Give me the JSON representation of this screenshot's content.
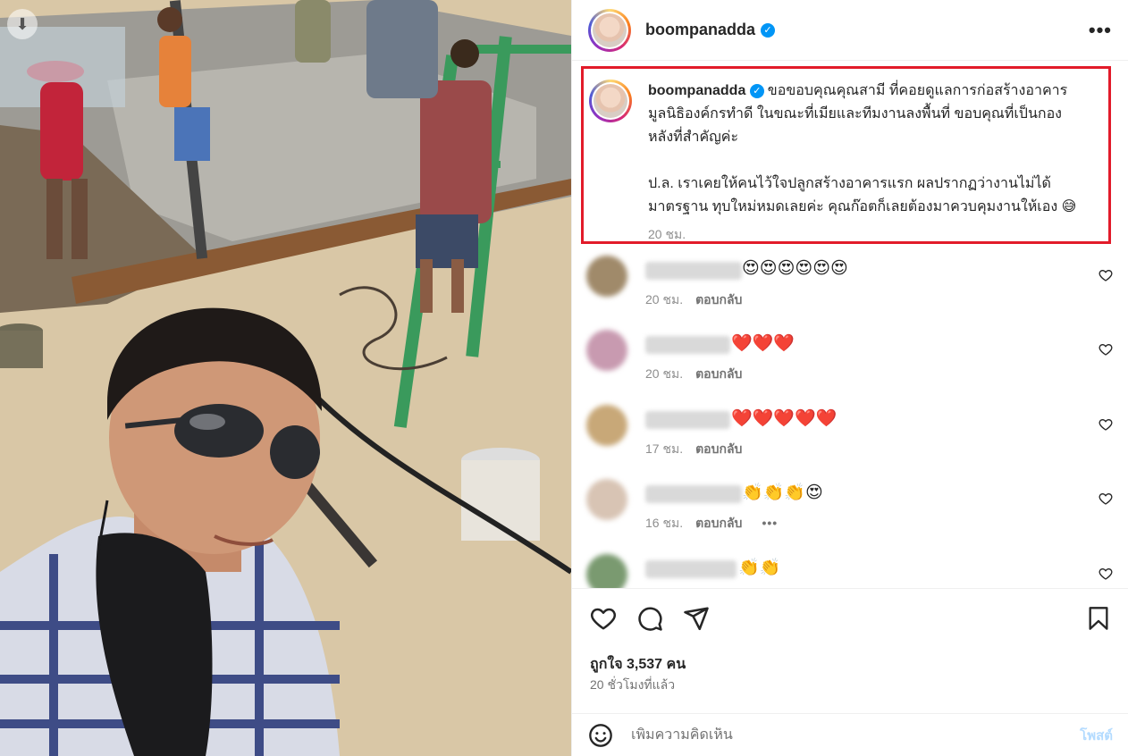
{
  "post": {
    "username": "boompanadda",
    "caption_username": "boompanadda",
    "caption": "ขอขอบคุณคุณสามี ที่คอยดูแลการก่อสร้างอาคาร\nมูลนิธิองค์กรทำดี ในขณะที่เมียและทีมงานลงพื้นที่ ขอบคุณที่เป็นกอง\nหลังที่สำคัญค่ะ\n\nป.ล. เราเคยให้คนไว้ใจปลูกสร้างอาคารแรก ผลปรากฏว่างานไม่ได้\nมาตรฐาน ทุบใหม่หมดเลยค่ะ คุณก๊อตก็เลยต้องมาควบคุมงานให้เอง 😅",
    "caption_time": "20 ชม."
  },
  "comments": [
    {
      "text": "😍😍😍😍😍😍",
      "time": "20 ชม.",
      "reply": "ตอบกลับ",
      "avatar_color": "#a08a6a"
    },
    {
      "text": "❤️❤️❤️",
      "time": "20 ชม.",
      "reply": "ตอบกลับ",
      "avatar_color": "#c89ab0"
    },
    {
      "text": "❤️❤️❤️❤️❤️",
      "time": "17 ชม.",
      "reply": "ตอบกลับ",
      "avatar_color": "#c8a878"
    },
    {
      "text": "👏👏👏😍",
      "time": "16 ชม.",
      "reply": "ตอบกลับ",
      "more": "•••",
      "avatar_color": "#d8c4b4"
    },
    {
      "text": "👏👏",
      "time": "",
      "reply": "",
      "avatar_color": "#7a9a70"
    }
  ],
  "likes": "ถูกใจ 3,537 คน",
  "posted_ago": "20 ชั่วโมงที่แล้ว",
  "add_comment": {
    "placeholder": "เพิ่มความคิดเห็น",
    "post_label": "โพสต์"
  },
  "icons": {
    "more": "more-options-icon",
    "verified": "verified-badge-icon",
    "download": "download-icon",
    "like": "heart-icon",
    "comment": "comment-icon",
    "share": "share-icon",
    "save": "bookmark-icon",
    "emoji": "emoji-icon"
  },
  "colors": {
    "verified": "#0095f6",
    "highlight_border": "#e21b2a",
    "post_button": "#b3dbff"
  }
}
